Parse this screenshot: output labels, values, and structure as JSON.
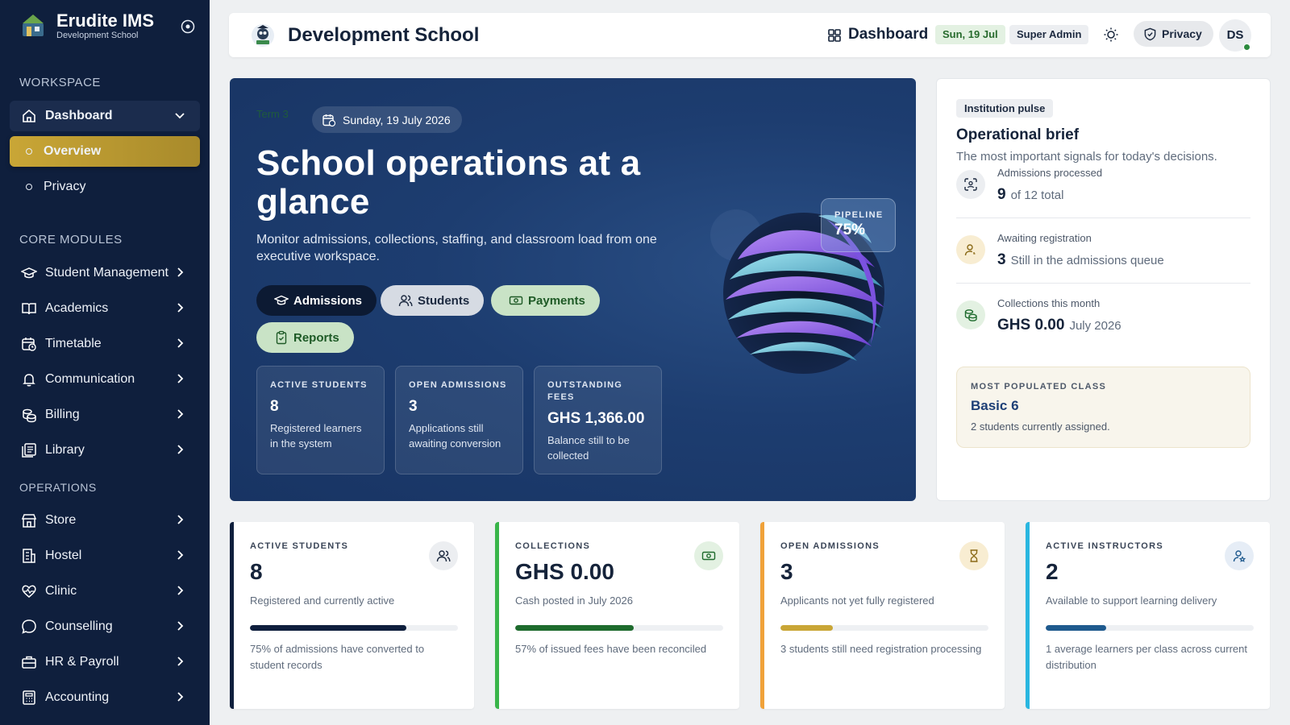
{
  "brand": {
    "name": "Erudite IMS",
    "subtitle": "Development School"
  },
  "sidebar": {
    "workspace_label": "WORKSPACE",
    "dashboard_label": "Dashboard",
    "overview_label": "Overview",
    "privacy_label": "Privacy",
    "core_label": "CORE MODULES",
    "core_items": [
      "Student Management",
      "Academics",
      "Timetable",
      "Communication",
      "Billing",
      "Library"
    ],
    "ops_label": "OPERATIONS",
    "ops_items": [
      "Store",
      "Hostel",
      "Clinic",
      "Counselling",
      "HR & Payroll",
      "Accounting"
    ]
  },
  "topbar": {
    "school_name": "Development School",
    "dashboard_label": "Dashboard",
    "date_pill": "Sun, 19 Jul",
    "role_pill": "Super Admin",
    "privacy_label": "Privacy",
    "avatar_initials": "DS"
  },
  "hero": {
    "term": "Term 3",
    "date": "Sunday, 19 July 2026",
    "title": "School operations at a glance",
    "description": "Monitor admissions, collections, staffing, and classroom load from one executive workspace.",
    "buttons": {
      "admissions": "Admissions",
      "students": "Students",
      "payments": "Payments",
      "reports": "Reports"
    },
    "stats": [
      {
        "label": "ACTIVE STUDENTS",
        "value": "8",
        "sub": "Registered learners in the system"
      },
      {
        "label": "OPEN ADMISSIONS",
        "value": "3",
        "sub": "Applications still awaiting conversion"
      },
      {
        "label": "OUTSTANDING FEES",
        "value": "GHS 1,366.00",
        "sub": "Balance still to be collected"
      }
    ],
    "pipeline_label": "PIPELINE",
    "pipeline_value": "75%"
  },
  "brief": {
    "tag": "Institution pulse",
    "title": "Operational brief",
    "description": "The most important signals for today's decisions.",
    "rows": [
      {
        "label": "Admissions processed",
        "value": "9",
        "note": "of 12 total"
      },
      {
        "label": "Awaiting registration",
        "value": "3",
        "note": "Still in the admissions queue"
      },
      {
        "label": "Collections this month",
        "value": "GHS 0.00",
        "note": "July 2026"
      }
    ],
    "populated": {
      "label": "MOST POPULATED CLASS",
      "value": "Basic 6",
      "sub": "2 students currently assigned."
    }
  },
  "kpis": [
    {
      "label": "ACTIVE STUDENTS",
      "value": "8",
      "sub": "Registered and currently active",
      "progress": 0.75,
      "note": "75% of admissions have converted to student records",
      "color": "#0f1f3d",
      "bar": "#0f1f3d",
      "icon_bg": "#eceef1"
    },
    {
      "label": "COLLECTIONS",
      "value": "GHS 0.00",
      "sub": "Cash posted in July 2026",
      "progress": 0.57,
      "note": "57% of issued fees have been reconciled",
      "color": "#39b54a",
      "bar": "#1e6b2d",
      "icon_bg": "#e3f1e2"
    },
    {
      "label": "OPEN ADMISSIONS",
      "value": "3",
      "sub": "Applicants not yet fully registered",
      "progress": 0.25,
      "note": "3 students still need registration processing",
      "color": "#f0a23a",
      "bar": "#c9a636",
      "icon_bg": "#f8edd2"
    },
    {
      "label": "ACTIVE INSTRUCTORS",
      "value": "2",
      "sub": "Available to support learning delivery",
      "progress": 0.29,
      "note": "1 average learners per class across current distribution",
      "color": "#29b6e0",
      "bar": "#1f5a8e",
      "icon_bg": "#e6edf6"
    }
  ]
}
